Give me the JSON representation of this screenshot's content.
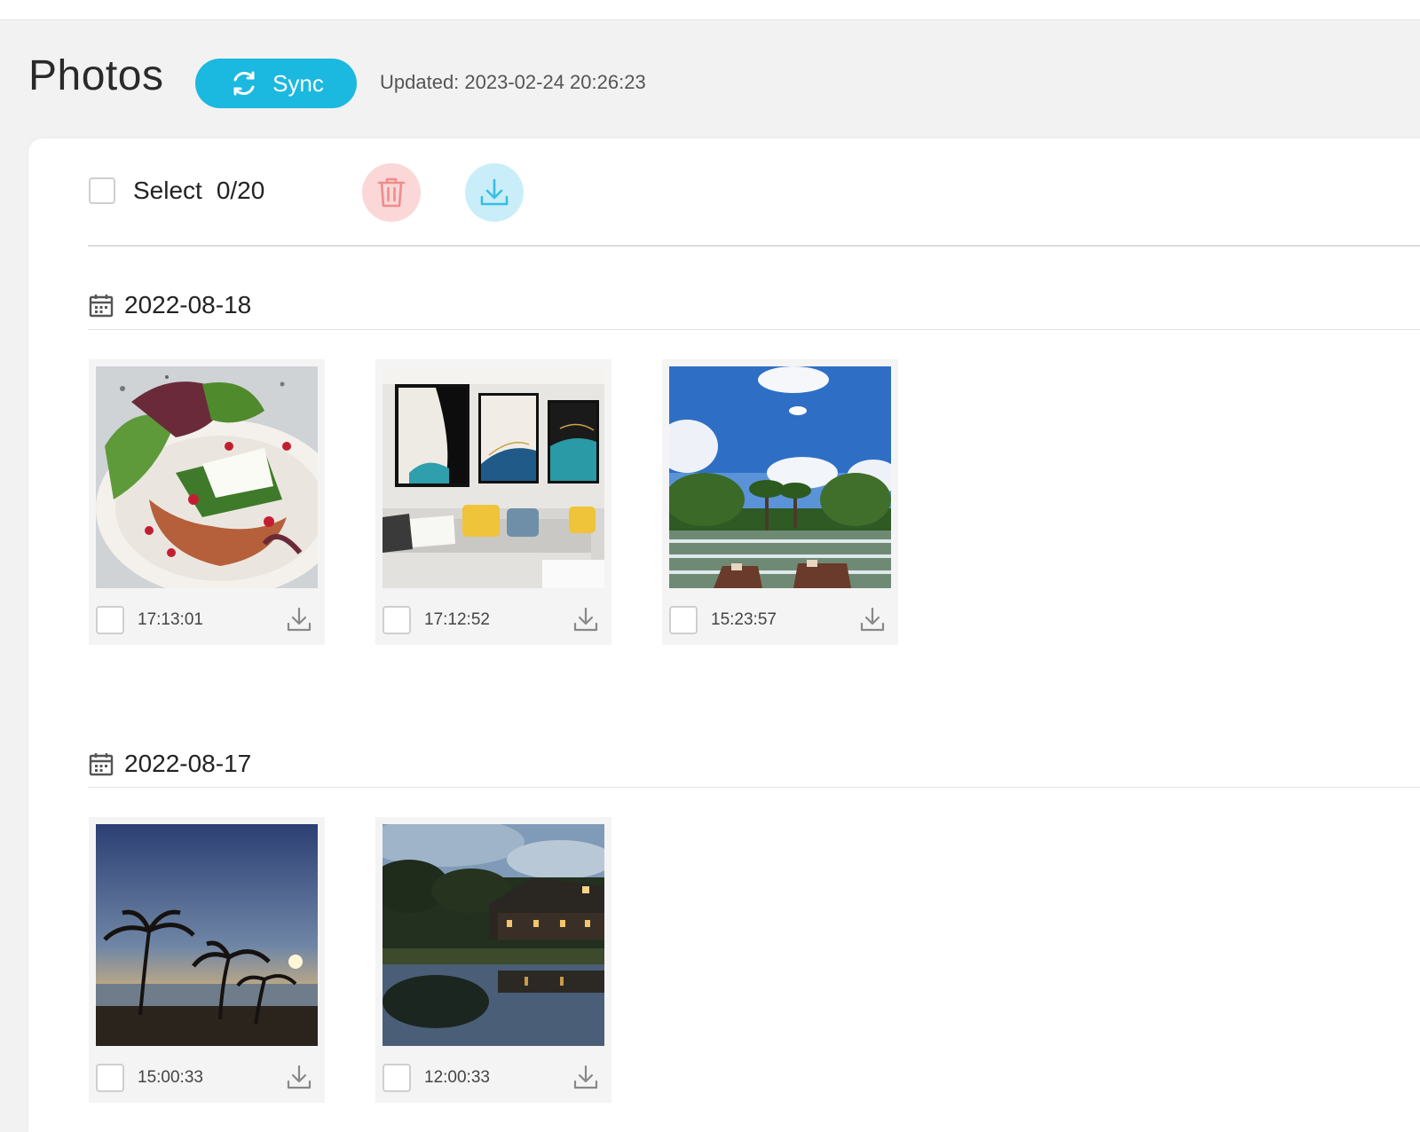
{
  "header": {
    "title": "Photos",
    "sync_label": "Sync",
    "updated_text": "Updated: 2023-02-24 20:26:23"
  },
  "toolbar": {
    "select_label": "Select",
    "select_count": "0/20",
    "delete_icon": "trash-icon",
    "download_icon": "download-icon"
  },
  "groups": [
    {
      "date": "2022-08-18",
      "photos": [
        {
          "time": "17:13:01",
          "subject": "salad"
        },
        {
          "time": "17:12:52",
          "subject": "living-room"
        },
        {
          "time": "15:23:57",
          "subject": "resort-pool"
        }
      ]
    },
    {
      "date": "2022-08-17",
      "photos": [
        {
          "time": "15:00:33",
          "subject": "sunset-palms"
        },
        {
          "time": "12:00:33",
          "subject": "lake-house"
        }
      ]
    }
  ],
  "colors": {
    "accent": "#1bb8e0",
    "delete_bg": "#fbd7d7",
    "delete_fg": "#f08c8c",
    "download_bg": "#c9eef9",
    "download_fg": "#39bde3"
  }
}
